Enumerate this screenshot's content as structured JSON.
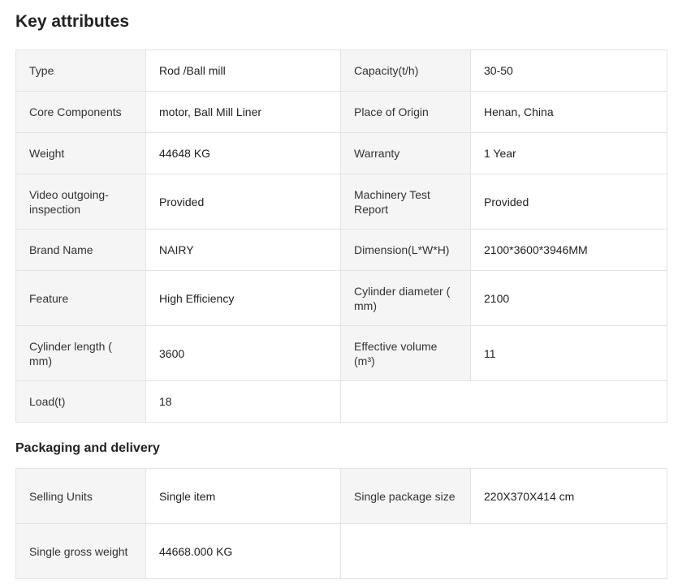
{
  "key_attributes": {
    "title": "Key attributes",
    "rows": [
      {
        "label1": "Type",
        "value1": "Rod /Ball mill",
        "label2": "Capacity(t/h)",
        "value2": "30-50"
      },
      {
        "label1": "Core Components",
        "value1": "motor, Ball Mill Liner",
        "label2": "Place of Origin",
        "value2": "Henan, China"
      },
      {
        "label1": "Weight",
        "value1": "44648 KG",
        "label2": "Warranty",
        "value2": "1 Year"
      },
      {
        "label1": "Video outgoing-inspection",
        "value1": "Provided",
        "label2": "Machinery Test Report",
        "value2": "Provided"
      },
      {
        "label1": "Brand Name",
        "value1": "NAIRY",
        "label2": "Dimension(L*W*H)",
        "value2": "2100*3600*3946MM"
      },
      {
        "label1": "Feature",
        "value1": "High Efficiency",
        "label2": "Cylinder diameter ( mm)",
        "value2": "2100"
      },
      {
        "label1": "Cylinder length ( mm)",
        "value1": "3600",
        "label2": "Effective volume (m³)",
        "value2": "11"
      },
      {
        "label1": "Load(t)",
        "value1": "18"
      }
    ]
  },
  "packaging": {
    "title": "Packaging and delivery",
    "rows": [
      {
        "label1": "Selling Units",
        "value1": "Single item",
        "label2": "Single package size",
        "value2": "220X370X414 cm"
      },
      {
        "label1": "Single gross weight",
        "value1": "44668.000 KG"
      }
    ]
  }
}
